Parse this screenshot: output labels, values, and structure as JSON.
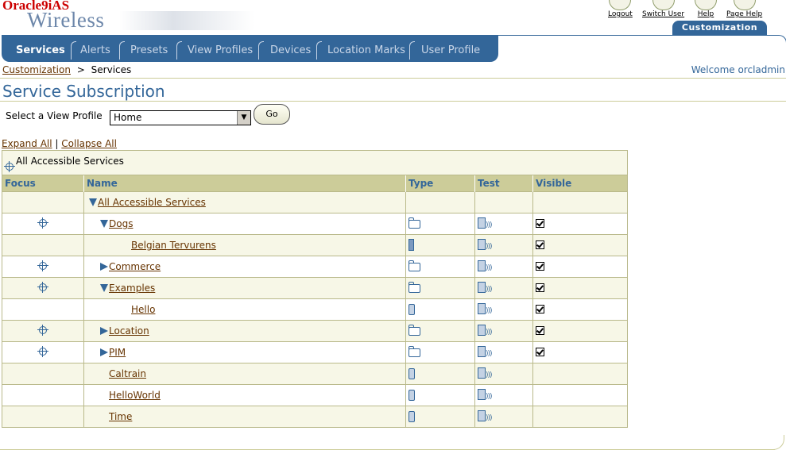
{
  "brand": {
    "oracle": "Oracle9iAS",
    "product": "Wireless"
  },
  "global_links": [
    {
      "label": "Logout",
      "icon": "logout-icon"
    },
    {
      "label": "Switch User",
      "icon": "switch-user-icon"
    },
    {
      "label": "Help",
      "icon": "help-icon"
    },
    {
      "label": "Page Help",
      "icon": "page-help-icon"
    }
  ],
  "top_tab": {
    "label": "Customization"
  },
  "nav_tabs": [
    {
      "label": "Services",
      "active": true
    },
    {
      "label": "Alerts"
    },
    {
      "label": "Presets"
    },
    {
      "label": "View Profiles"
    },
    {
      "label": "Devices"
    },
    {
      "label": "Location Marks"
    },
    {
      "label": "User Profile"
    }
  ],
  "breadcrumb": {
    "parent": "Customization",
    "separator": ">",
    "current": "Services"
  },
  "welcome": "Welcome orcladmin",
  "page_title": "Service Subscription",
  "view_profile": {
    "label": "Select a View Profile",
    "value": "Home",
    "go_label": "Go"
  },
  "expand_links": {
    "expand": "Expand All",
    "separator": "|",
    "collapse": "Collapse All"
  },
  "root_label": "All Accessible Services",
  "table": {
    "headers": [
      "Focus",
      "Name",
      "Type",
      "Test",
      "Visible"
    ],
    "rows": [
      {
        "name": "All Accessible Services",
        "indent": 0,
        "expander": "down",
        "focus": false,
        "type": "",
        "test": false,
        "visible": ""
      },
      {
        "name": "Dogs",
        "indent": 1,
        "expander": "down",
        "focus": true,
        "type": "folder",
        "test": true,
        "visible": "checked"
      },
      {
        "name": "Belgian Tervurens",
        "indent": 2,
        "expander": "",
        "focus": false,
        "type": "bookmark",
        "test": true,
        "visible": "checked"
      },
      {
        "name": "Commerce",
        "indent": 1,
        "expander": "right",
        "focus": true,
        "type": "folder",
        "test": true,
        "visible": "checked"
      },
      {
        "name": "Examples",
        "indent": 1,
        "expander": "down",
        "focus": true,
        "type": "folder",
        "test": true,
        "visible": "checked"
      },
      {
        "name": "Hello",
        "indent": 2,
        "expander": "",
        "focus": false,
        "type": "phone",
        "test": true,
        "visible": "checked"
      },
      {
        "name": "Location",
        "indent": 1,
        "expander": "right",
        "focus": true,
        "type": "folder",
        "test": true,
        "visible": "checked"
      },
      {
        "name": "PIM",
        "indent": 1,
        "expander": "right",
        "focus": true,
        "type": "folder",
        "test": true,
        "visible": "checked"
      },
      {
        "name": "Caltrain",
        "indent": 1,
        "expander": "",
        "focus": false,
        "type": "phone",
        "test": true,
        "visible": ""
      },
      {
        "name": "HelloWorld",
        "indent": 1,
        "expander": "",
        "focus": false,
        "type": "phone",
        "test": true,
        "visible": ""
      },
      {
        "name": "Time",
        "indent": 1,
        "expander": "",
        "focus": false,
        "type": "phone",
        "test": true,
        "visible": ""
      }
    ]
  },
  "colors": {
    "nav_blue": "#336699",
    "header_tan": "#cccc99",
    "link_brown": "#663300",
    "brand_red": "#cc0000"
  }
}
